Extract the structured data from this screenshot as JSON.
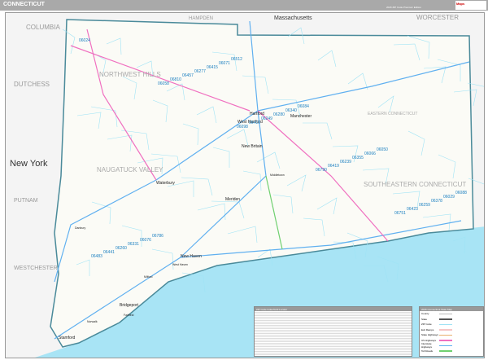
{
  "header": {
    "title": "CONNECTICUT",
    "edition": "2026 ZIP Code Premium Edition",
    "logo": "Maps"
  },
  "regions": {
    "outside": [
      "COLUMBIA",
      "HAMPDEN",
      "Massachusetts",
      "WORCESTER",
      "DUTCHESS",
      "New York",
      "PUTNAM",
      "WESTCHESTER"
    ],
    "inside": [
      "NORTHWEST HILLS",
      "NAUGATUCK VALLEY",
      "SOUTHEASTERN CONNECTICUT",
      "EASTERN CONNECTICUT"
    ]
  },
  "cities": [
    "Hartford",
    "West Hartford",
    "Manchester",
    "New Britain",
    "Meriden",
    "Waterbury",
    "Danbury",
    "New Haven",
    "West Haven",
    "Milford",
    "Bridgeport",
    "Fairfield",
    "Stamford",
    "Norwalk",
    "Middletown"
  ],
  "zips": [
    "06024",
    "06058",
    "06098",
    "06790",
    "06751",
    "06483",
    "06810",
    "06416",
    "06419",
    "06423",
    "06441",
    "06457",
    "06249",
    "06239",
    "06259",
    "06260",
    "06277",
    "06280",
    "06355",
    "06378",
    "06331",
    "06415",
    "06340",
    "06066",
    "06029",
    "06076",
    "06071",
    "06084",
    "06050",
    "06088",
    "06786",
    "06512"
  ],
  "legend": {
    "title": "2026 Connecticut State Map",
    "items": [
      {
        "label": "County",
        "color": "#bbbbbb"
      },
      {
        "label": "State",
        "color": "#555555"
      },
      {
        "label": "ZIP Code",
        "color": "#9fe3f5"
      },
      {
        "label": "Exit Ramps",
        "color": "#f5c6c6"
      },
      {
        "label": "State Highways",
        "color": "#e8b070"
      },
      {
        "label": "US Highways",
        "color": "#f070c0"
      },
      {
        "label": "Interstate Highways",
        "color": "#60b0f0"
      },
      {
        "label": "Toll Roads",
        "color": "#70d070"
      }
    ]
  },
  "zip_index": {
    "title": "ZIP Code Index/Grid Locator"
  }
}
